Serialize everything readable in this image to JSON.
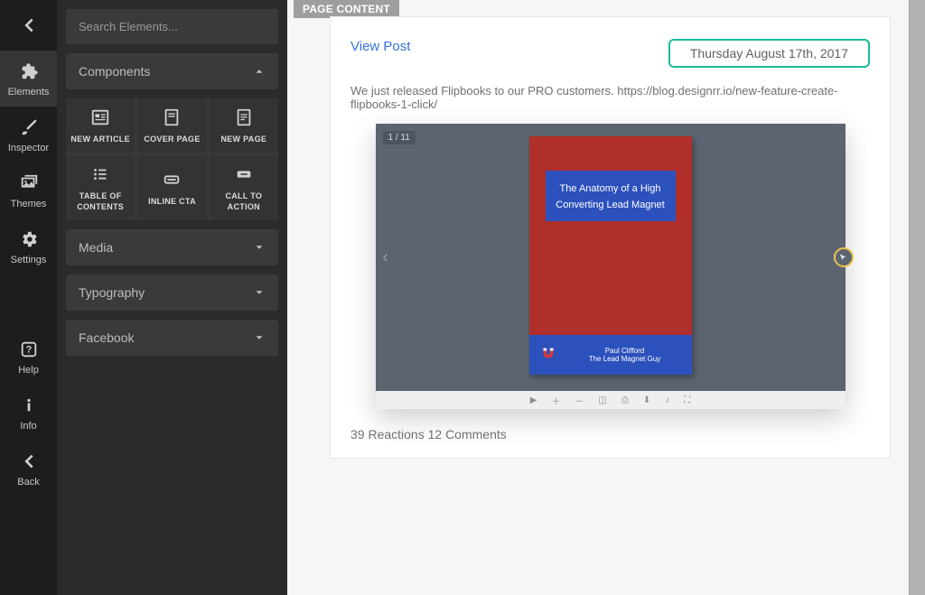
{
  "rail": {
    "items": [
      {
        "label": "Elements"
      },
      {
        "label": "Inspector"
      },
      {
        "label": "Themes"
      },
      {
        "label": "Settings"
      }
    ],
    "secondary": [
      {
        "label": "Help"
      },
      {
        "label": "Info"
      },
      {
        "label": "Back"
      }
    ]
  },
  "panel": {
    "search_placeholder": "Search Elements...",
    "sections": {
      "components": "Components",
      "media": "Media",
      "typography": "Typography",
      "facebook": "Facebook"
    },
    "tiles": [
      {
        "label": "NEW ARTICLE"
      },
      {
        "label": "COVER PAGE"
      },
      {
        "label": "NEW PAGE"
      },
      {
        "label": "TABLE OF\nCONTENTS"
      },
      {
        "label": "INLINE CTA"
      },
      {
        "label": "CALL TO\nACTION"
      }
    ]
  },
  "stage": {
    "crumb": "PAGE CONTENT",
    "view_post": "View Post",
    "date": "Thursday August 17th, 2017",
    "description": "We just released Flipbooks to our PRO customers. https://blog.designrr.io/new-feature-create-flipbooks-1-click/",
    "viewer": {
      "page_counter": "1 / 11",
      "cover_title": "The Anatomy of a High Converting Lead Magnet",
      "cover_author": "Paul Clifford",
      "cover_subtitle": "The Lead Magnet Guy"
    },
    "meta": "39 Reactions 12 Comments"
  }
}
